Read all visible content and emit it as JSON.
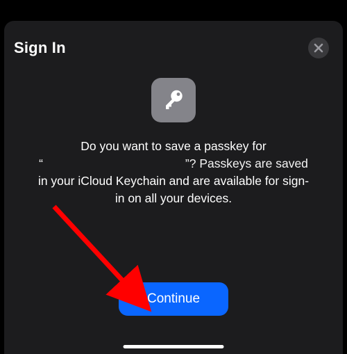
{
  "sheet": {
    "title": "Sign In",
    "message_l1": "Do you want to save a passkey for",
    "message_quote_open": "“",
    "message_quote_close": "”? Passkeys are saved",
    "message_l3": "in your iCloud Keychain and are available for sign-",
    "message_l4": "in on all your devices.",
    "continue_label": "Continue"
  },
  "icons": {
    "close": "close-icon",
    "passkey": "key-icon"
  },
  "colors": {
    "accent": "#0a66ff",
    "sheet_bg": "#1c1c1e",
    "tile_bg": "#84848a"
  },
  "annotation": {
    "arrow_color": "#ff0000"
  }
}
